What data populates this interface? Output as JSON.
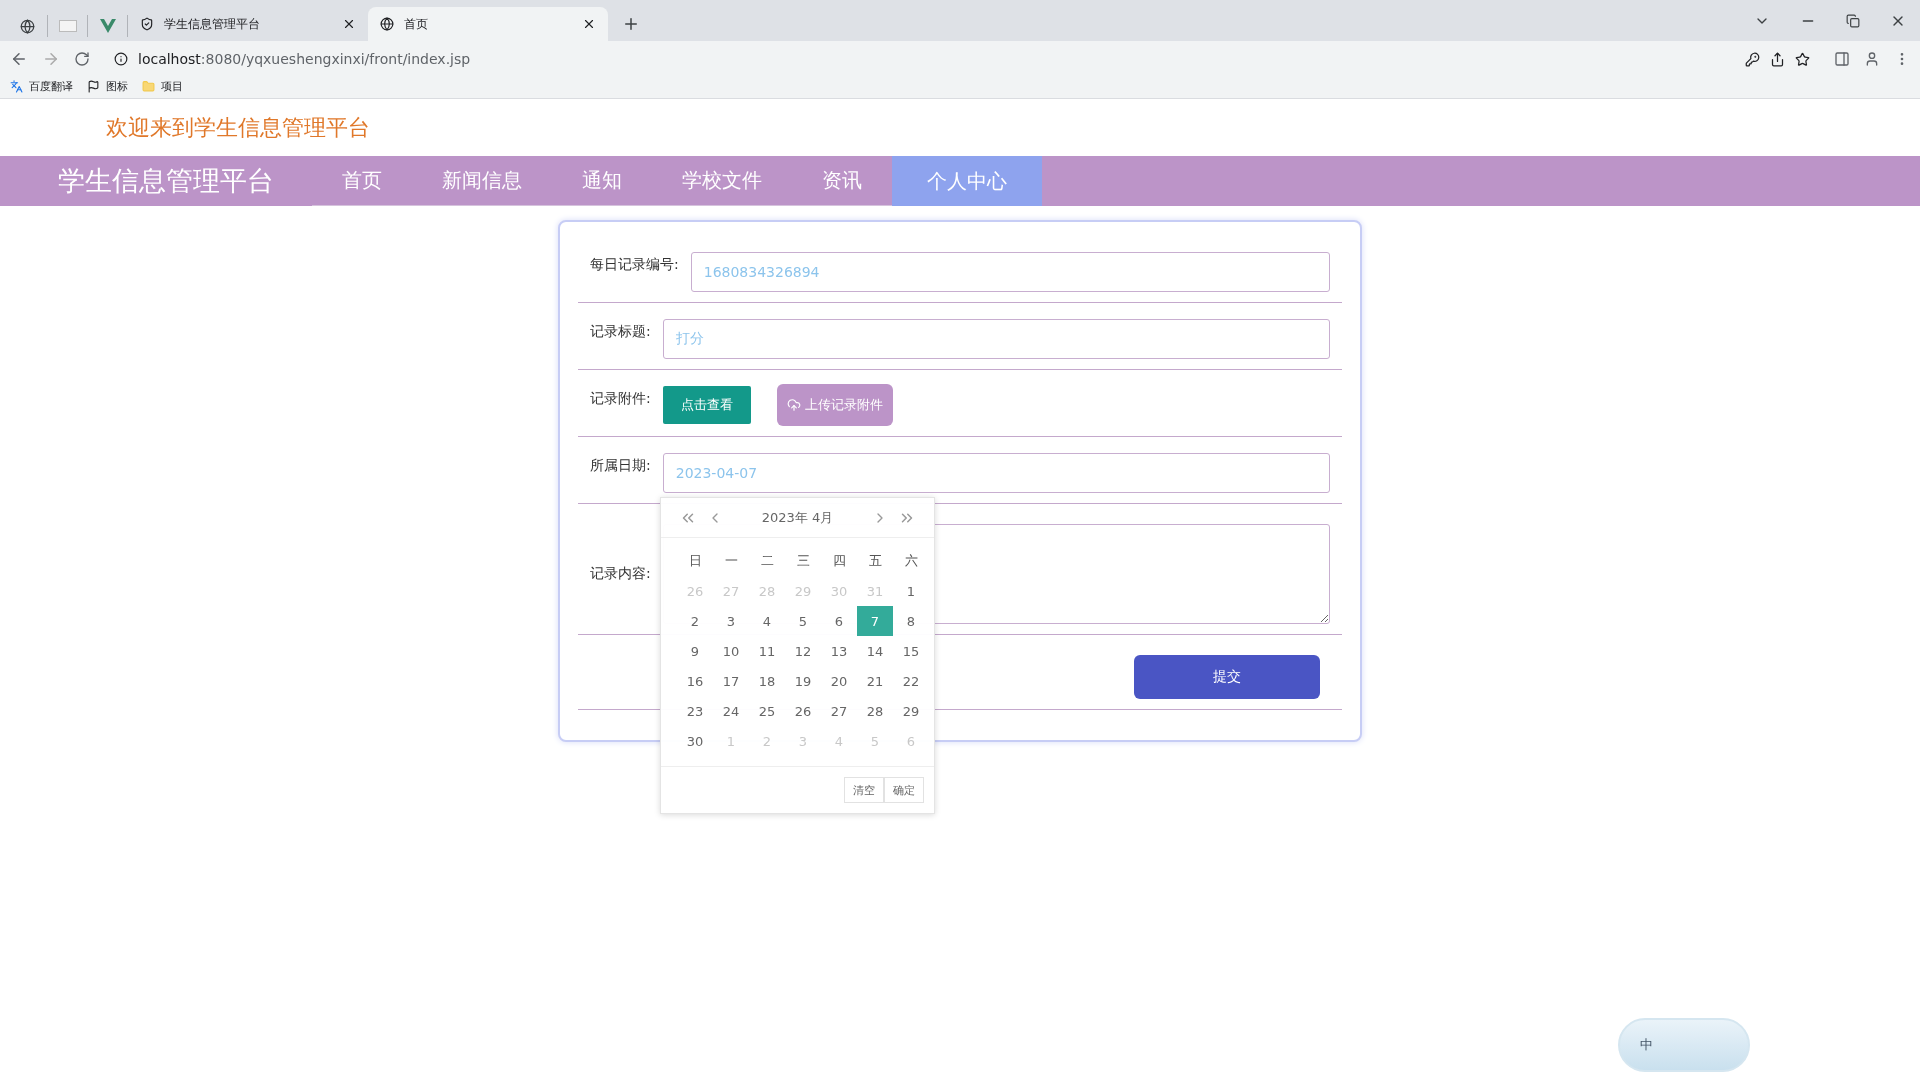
{
  "browser": {
    "tabs": [
      {
        "title": "学生信息管理平台",
        "selected": false
      },
      {
        "title": "首页",
        "selected": true
      }
    ],
    "address": {
      "host": "localhost",
      "path": ":8080/yqxueshengxinxi/front/index.jsp"
    },
    "bookmarks": [
      "百度翻译",
      "图标",
      "项目"
    ]
  },
  "welcome": "欢迎来到学生信息管理平台",
  "nav": {
    "brand": "学生信息管理平台",
    "items": [
      {
        "label": "首页",
        "selected": false
      },
      {
        "label": "新闻信息",
        "selected": false
      },
      {
        "label": "通知",
        "selected": false
      },
      {
        "label": "学校文件",
        "selected": false
      },
      {
        "label": "资讯",
        "selected": false
      },
      {
        "label": "个人中心",
        "selected": true
      }
    ]
  },
  "form": {
    "rows": [
      {
        "kind": "input",
        "label": "每日记录编号:",
        "value": "1680834326894"
      },
      {
        "kind": "input",
        "label": "记录标题:",
        "value": "打分"
      },
      {
        "kind": "files",
        "label": "记录附件:",
        "buttons": [
          "点击查看",
          "上传记录附件"
        ]
      },
      {
        "kind": "date",
        "label": "所属日期:",
        "value": "2023-04-07"
      },
      {
        "kind": "textarea",
        "label": "记录内容:"
      }
    ],
    "submit": "提交"
  },
  "calendar": {
    "year": "2023年",
    "month": "4月",
    "weekdays": [
      "日",
      "一",
      "二",
      "三",
      "四",
      "五",
      "六"
    ],
    "days": [
      {
        "day": "26",
        "muted": true,
        "selected": false
      },
      {
        "day": "27",
        "muted": true,
        "selected": false
      },
      {
        "day": "28",
        "muted": true,
        "selected": false
      },
      {
        "day": "29",
        "muted": true,
        "selected": false
      },
      {
        "day": "30",
        "muted": true,
        "selected": false
      },
      {
        "day": "31",
        "muted": true,
        "selected": false
      },
      {
        "day": "1",
        "muted": false,
        "selected": false
      },
      {
        "day": "2",
        "muted": false,
        "selected": false
      },
      {
        "day": "3",
        "muted": false,
        "selected": false
      },
      {
        "day": "4",
        "muted": false,
        "selected": false
      },
      {
        "day": "5",
        "muted": false,
        "selected": false
      },
      {
        "day": "6",
        "muted": false,
        "selected": false
      },
      {
        "day": "7",
        "muted": false,
        "selected": true
      },
      {
        "day": "8",
        "muted": false,
        "selected": false
      },
      {
        "day": "9",
        "muted": false,
        "selected": false
      },
      {
        "day": "10",
        "muted": false,
        "selected": false
      },
      {
        "day": "11",
        "muted": false,
        "selected": false
      },
      {
        "day": "12",
        "muted": false,
        "selected": false
      },
      {
        "day": "13",
        "muted": false,
        "selected": false
      },
      {
        "day": "14",
        "muted": false,
        "selected": false
      },
      {
        "day": "15",
        "muted": false,
        "selected": false
      },
      {
        "day": "16",
        "muted": false,
        "selected": false
      },
      {
        "day": "17",
        "muted": false,
        "selected": false
      },
      {
        "day": "18",
        "muted": false,
        "selected": false
      },
      {
        "day": "19",
        "muted": false,
        "selected": false
      },
      {
        "day": "20",
        "muted": false,
        "selected": false
      },
      {
        "day": "21",
        "muted": false,
        "selected": false
      },
      {
        "day": "22",
        "muted": false,
        "selected": false
      },
      {
        "day": "23",
        "muted": false,
        "selected": false
      },
      {
        "day": "24",
        "muted": false,
        "selected": false
      },
      {
        "day": "25",
        "muted": false,
        "selected": false
      },
      {
        "day": "26",
        "muted": false,
        "selected": false
      },
      {
        "day": "27",
        "muted": false,
        "selected": false
      },
      {
        "day": "28",
        "muted": false,
        "selected": false
      },
      {
        "day": "29",
        "muted": false,
        "selected": false
      },
      {
        "day": "30",
        "muted": false,
        "selected": false
      },
      {
        "day": "1",
        "muted": true,
        "selected": false
      },
      {
        "day": "2",
        "muted": true,
        "selected": false
      },
      {
        "day": "3",
        "muted": true,
        "selected": false
      },
      {
        "day": "4",
        "muted": true,
        "selected": false
      },
      {
        "day": "5",
        "muted": true,
        "selected": false
      },
      {
        "day": "6",
        "muted": true,
        "selected": false
      }
    ],
    "buttons": [
      "清空",
      "确定"
    ]
  },
  "ime": {
    "label": "中"
  }
}
